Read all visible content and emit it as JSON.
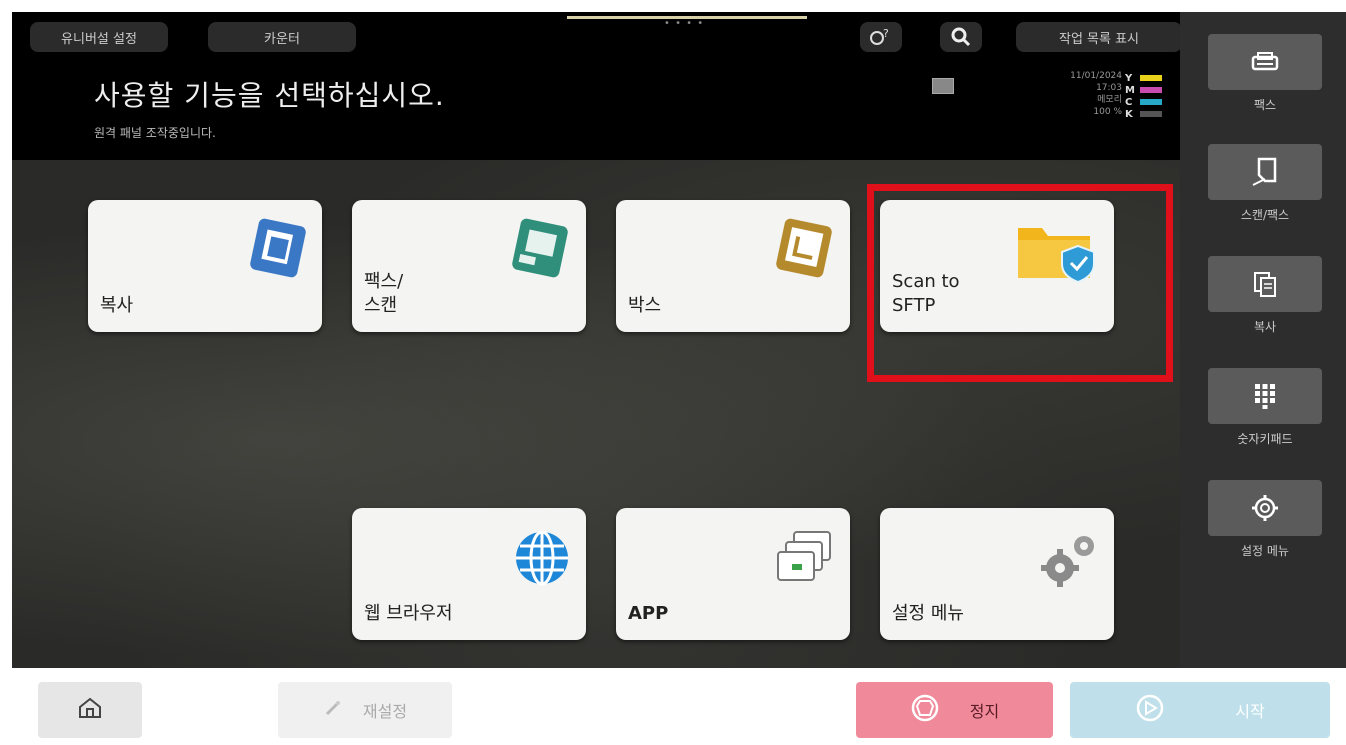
{
  "topbar": {
    "universal_label": "유니버설 설정",
    "counter_label": "카운터",
    "joblist_label": "작업 목록 표시",
    "title": "사용할 기능을 선택하십시오.",
    "subtitle": "원격 패널 조작중입니다.",
    "date": "11/01/2024",
    "time": "17:03",
    "memory_label": "메모리",
    "memory_value": "100 %",
    "toner": [
      {
        "letter": "Y",
        "color": "#e8d21c"
      },
      {
        "letter": "M",
        "color": "#c84bb0"
      },
      {
        "letter": "C",
        "color": "#27a8c8"
      },
      {
        "letter": "K",
        "color": "#555555"
      }
    ]
  },
  "tiles": [
    {
      "label": "복사",
      "icon": "copy-icon"
    },
    {
      "label": "팩스/\n스캔",
      "icon": "fax-scan-icon"
    },
    {
      "label": "박스",
      "icon": "box-icon"
    },
    {
      "label": "Scan to\nSFTP",
      "icon": "sftp-folder-shield-icon"
    },
    {
      "label": "웹 브라우저",
      "icon": "globe-icon"
    },
    {
      "label": "APP",
      "icon": "app-windows-icon"
    },
    {
      "label": "설정 메뉴",
      "icon": "gear-icon"
    }
  ],
  "sidebar": [
    {
      "label": "팩스",
      "icon": "printer-icon"
    },
    {
      "label": "스캔/팩스",
      "icon": "scan-doc-icon"
    },
    {
      "label": "복사",
      "icon": "copy-pages-icon"
    },
    {
      "label": "숫자키패드",
      "icon": "keypad-icon"
    },
    {
      "label": "설정 메뉴",
      "icon": "settings-gear-icon"
    }
  ],
  "bottombar": {
    "reset_label": "재설정",
    "stop_label": "정지",
    "start_label": "시작"
  },
  "colors": {
    "highlight": "#e0101a",
    "stop_button": "#f08a9a",
    "start_button": "#bfe0ea"
  }
}
